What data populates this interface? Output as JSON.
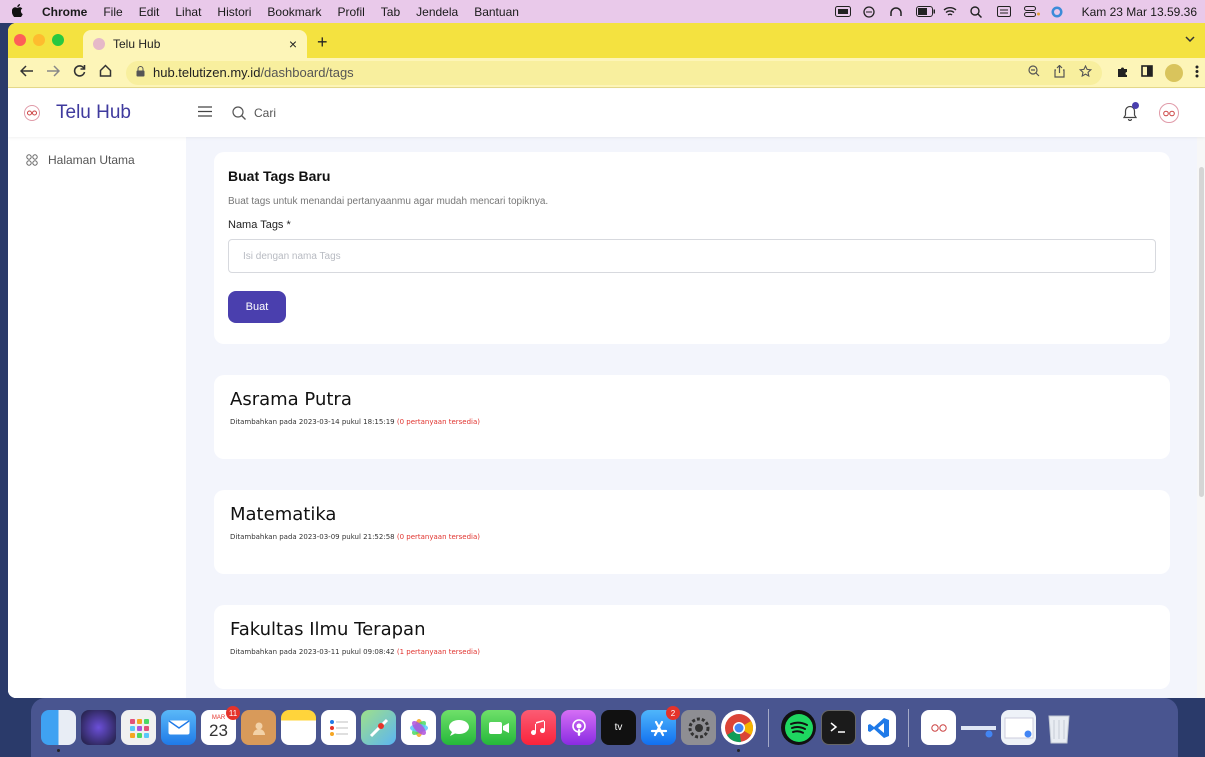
{
  "menubar": {
    "apple": "",
    "items": [
      "Chrome",
      "File",
      "Edit",
      "Lihat",
      "Histori",
      "Bookmark",
      "Profil",
      "Tab",
      "Jendela",
      "Bantuan"
    ],
    "clock": "Kam 23 Mar 13.59.36"
  },
  "browser": {
    "tab_title": "Telu Hub",
    "tab_close": "×",
    "new_tab": "+",
    "url_host": "hub.telutizen.my.id",
    "url_path": "/dashboard/tags"
  },
  "site": {
    "brand": "Telu Hub",
    "search_placeholder": "Cari",
    "sidebar": {
      "items": [
        {
          "label": "Halaman Utama"
        }
      ]
    },
    "create": {
      "title": "Buat Tags Baru",
      "description": "Buat tags untuk menandai pertanyaanmu agar mudah mencari topiknya.",
      "field_label": "Nama Tags *",
      "input_placeholder": "Isi dengan nama Tags",
      "input_value": "",
      "button_label": "Buat"
    },
    "tags": [
      {
        "name": "Asrama Putra",
        "added": "Ditambahkan pada 2023-03-14 pukul 18:15:19",
        "count": "(0 pertanyaan tersedia)"
      },
      {
        "name": "Matematika",
        "added": "Ditambahkan pada 2023-03-09 pukul 21:52:58",
        "count": "(0 pertanyaan tersedia)"
      },
      {
        "name": "Fakultas Ilmu Terapan",
        "added": "Ditambahkan pada 2023-03-11 pukul 09:08:42",
        "count": "(1 pertanyaan tersedia)"
      }
    ],
    "colors": {
      "primary": "#4a3fae",
      "count_red": "#e0332e",
      "page_bg": "#f3f5fc"
    }
  },
  "dock": {
    "calendar_month": "MAR",
    "calendar_day": "23",
    "calendar_badge": "11",
    "appstore_badge": "2",
    "tv_label": "tv"
  }
}
